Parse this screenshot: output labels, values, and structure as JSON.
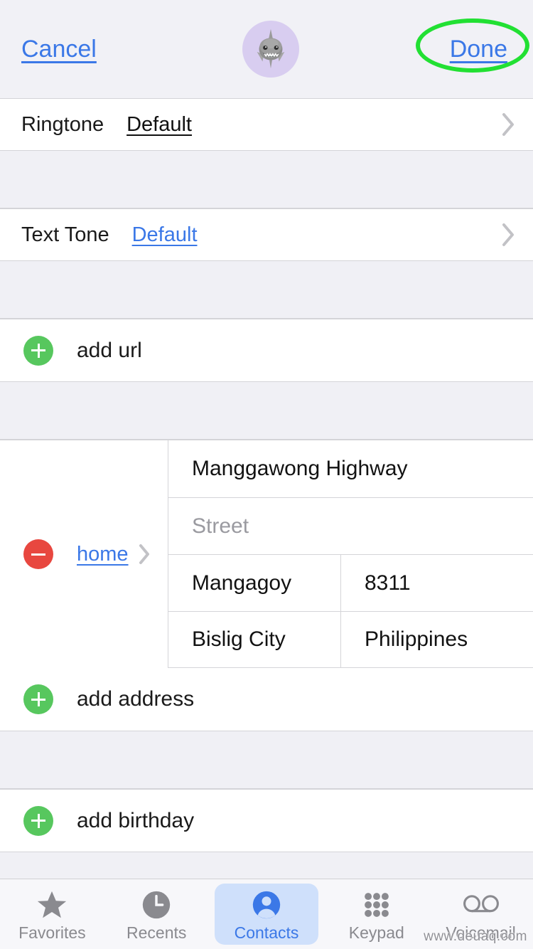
{
  "navbar": {
    "cancel_label": "Cancel",
    "done_label": "Done",
    "avatar_icon": "shark-emoji-avatar",
    "avatar_bg": "#d8cdf0",
    "link_color": "#3b78e7",
    "highlight_color": "#22e033",
    "highlight_target": "Done"
  },
  "sections": {
    "ringtone": {
      "label": "Ringtone",
      "value": "Default",
      "value_style": "dark",
      "chevron_icon": "chevron-right-icon"
    },
    "text_tone": {
      "label": "Text Tone",
      "value": "Default",
      "value_style": "link",
      "chevron_icon": "chevron-right-icon"
    },
    "add_url": {
      "label": "add url",
      "icon": "plus-circle-icon",
      "icon_color": "#57c75e"
    },
    "address": {
      "remove_icon": "minus-circle-icon",
      "remove_color": "#e8473f",
      "type_label": "home",
      "type_chevron_icon": "chevron-right-icon",
      "street1": "Manggawong Highway",
      "street2_placeholder": "Street",
      "city": "Mangagoy",
      "zip": "8311",
      "state": "Bislig City",
      "country": "Philippines"
    },
    "add_address": {
      "label": "add address",
      "icon": "plus-circle-icon",
      "icon_color": "#57c75e"
    },
    "add_birthday": {
      "label": "add birthday",
      "icon": "plus-circle-icon",
      "icon_color": "#57c75e"
    }
  },
  "tabbar": {
    "active": "Contacts",
    "active_color": "#3b78e7",
    "inactive_color": "#8a8a8f",
    "items": [
      {
        "label": "Favorites",
        "icon": "star-icon"
      },
      {
        "label": "Recents",
        "icon": "clock-icon"
      },
      {
        "label": "Contacts",
        "icon": "person-circle-icon"
      },
      {
        "label": "Keypad",
        "icon": "keypad-grid-icon"
      },
      {
        "label": "Voicemail",
        "icon": "voicemail-icon"
      }
    ]
  },
  "watermark": "www.deuaq.com"
}
